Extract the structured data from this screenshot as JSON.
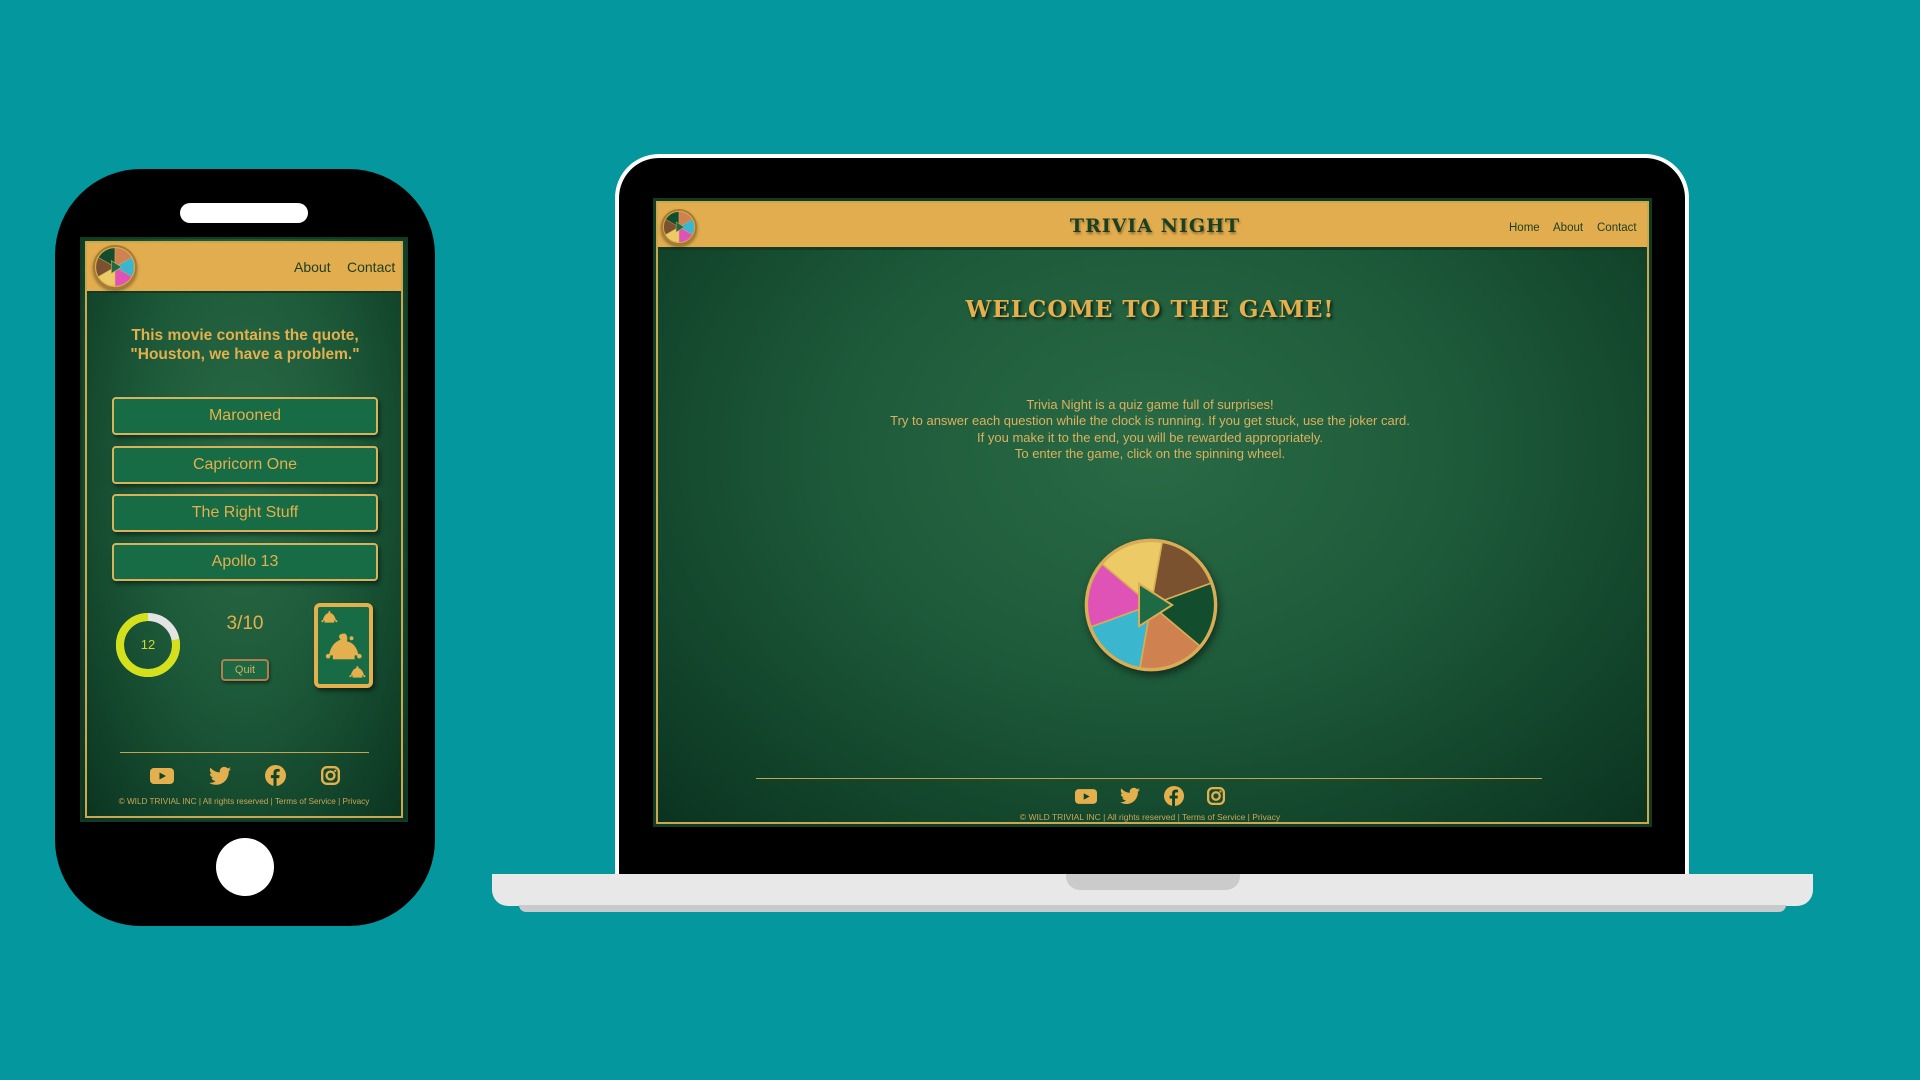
{
  "background_color": "#05979e",
  "phone": {
    "nav": [
      "About",
      "Contact"
    ],
    "question": "This movie contains the quote, \"Houston, we have a problem.\"",
    "answers": [
      "Marooned",
      "Capricorn One",
      "The Right Stuff",
      "Apollo 13"
    ],
    "timer": {
      "value": "12",
      "remaining_fraction": 0.78
    },
    "score": "3/10",
    "quit_label": "Quit",
    "joker_card": "jester-hat-icon",
    "social": [
      "youtube-icon",
      "twitter-icon",
      "facebook-icon",
      "instagram-icon"
    ],
    "footer": {
      "copyright": "© WILD TRIVIAL INC | All rights reserved | ",
      "terms": "Terms of Service",
      "sep": " | ",
      "privacy": "Privacy"
    }
  },
  "laptop": {
    "brand": "TRIVIA NIGHT",
    "nav": [
      "Home",
      "About",
      "Contact"
    ],
    "welcome": "WELCOME TO THE GAME!",
    "intro": [
      "Trivia Night is a quiz game full of surprises!",
      "Try to answer each question while the clock is running. If you get stuck, use the joker card.",
      "If you make it to the end, you will be rewarded appropriately.",
      "To enter the game, click on the spinning wheel."
    ],
    "social": [
      "youtube-icon",
      "twitter-icon",
      "facebook-icon",
      "instagram-icon"
    ],
    "footer": {
      "copyright": "© WILD TRIVIAL INC | All rights reserved | ",
      "terms": "Terms of Service",
      "sep": " | ",
      "privacy": "Privacy"
    }
  },
  "colors": {
    "header_gold": "#e2ad4e",
    "text_gold": "#e4b04d",
    "felt_green": "#1d5a3a",
    "button_green": "#176b45",
    "timer_yellow": "#d4e01a",
    "wheel_segments": [
      "#7a5230",
      "#124d2e",
      "#cf8150",
      "#3ab6cf",
      "#de53b5",
      "#ecca66"
    ]
  }
}
